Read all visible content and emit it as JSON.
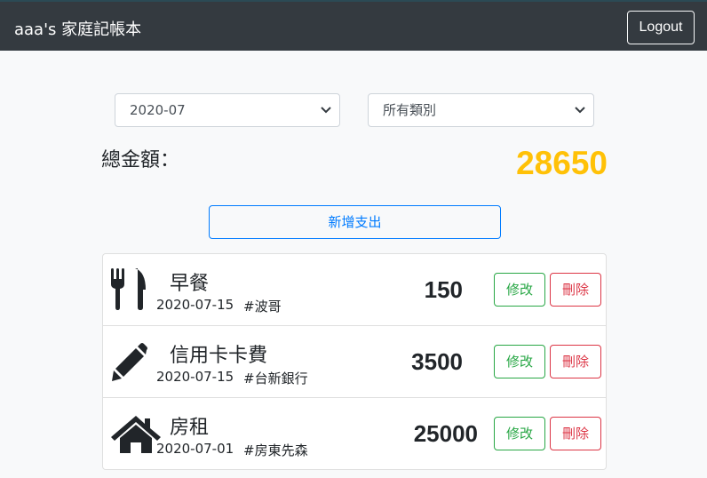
{
  "header": {
    "title": "aaa's 家庭記帳本",
    "logout_label": "Logout"
  },
  "filters": {
    "month": {
      "selected": "2020-07"
    },
    "category": {
      "selected": "所有類別"
    }
  },
  "summary": {
    "label": "總金額：",
    "total": "28650"
  },
  "add_button_label": "新增支出",
  "colors": {
    "navbar": "#343a40",
    "total": "#ffc107",
    "edit": "#28a745",
    "delete": "#dc3545",
    "add": "#007bff"
  },
  "records": [
    {
      "icon": "utensils-icon",
      "name": "早餐",
      "date": "2020-07-15",
      "tag": "#波哥",
      "amount": "150",
      "edit_label": "修改",
      "delete_label": "刪除"
    },
    {
      "icon": "pencil-icon",
      "name": "信用卡卡費",
      "date": "2020-07-15",
      "tag": "#台新銀行",
      "amount": "3500",
      "edit_label": "修改",
      "delete_label": "刪除"
    },
    {
      "icon": "home-icon",
      "name": "房租",
      "date": "2020-07-01",
      "tag": "#房東先森",
      "amount": "25000",
      "edit_label": "修改",
      "delete_label": "刪除"
    }
  ]
}
